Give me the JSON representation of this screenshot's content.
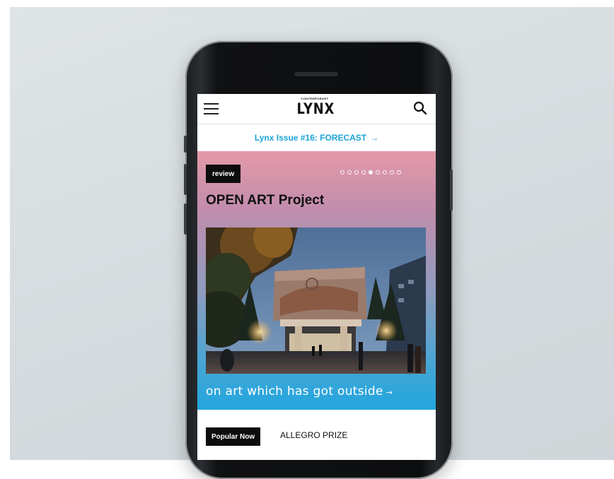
{
  "app": {
    "logo_small": "CONTEMPORARY",
    "logo_main": "LYNX"
  },
  "topbar": {
    "menu_icon": "hamburger-menu-icon",
    "search_icon": "search-icon"
  },
  "issue_banner": {
    "label": "Lynx Issue #16: FORECAST",
    "arrow": "→"
  },
  "hero": {
    "tag": "review",
    "title": "OPEN ART Project",
    "subtitle": "on art which has got outside",
    "subtitle_arrow": "→",
    "slides_total": 9,
    "active_slide": 5
  },
  "popular": {
    "tag": "Popular Now",
    "link": "ALLEGRO PRIZE"
  },
  "colors": {
    "accent": "#1ba3d6",
    "hero_top": "#e49aa8",
    "hero_bottom": "#22a6df",
    "tag_bg": "#0d0d0d"
  }
}
